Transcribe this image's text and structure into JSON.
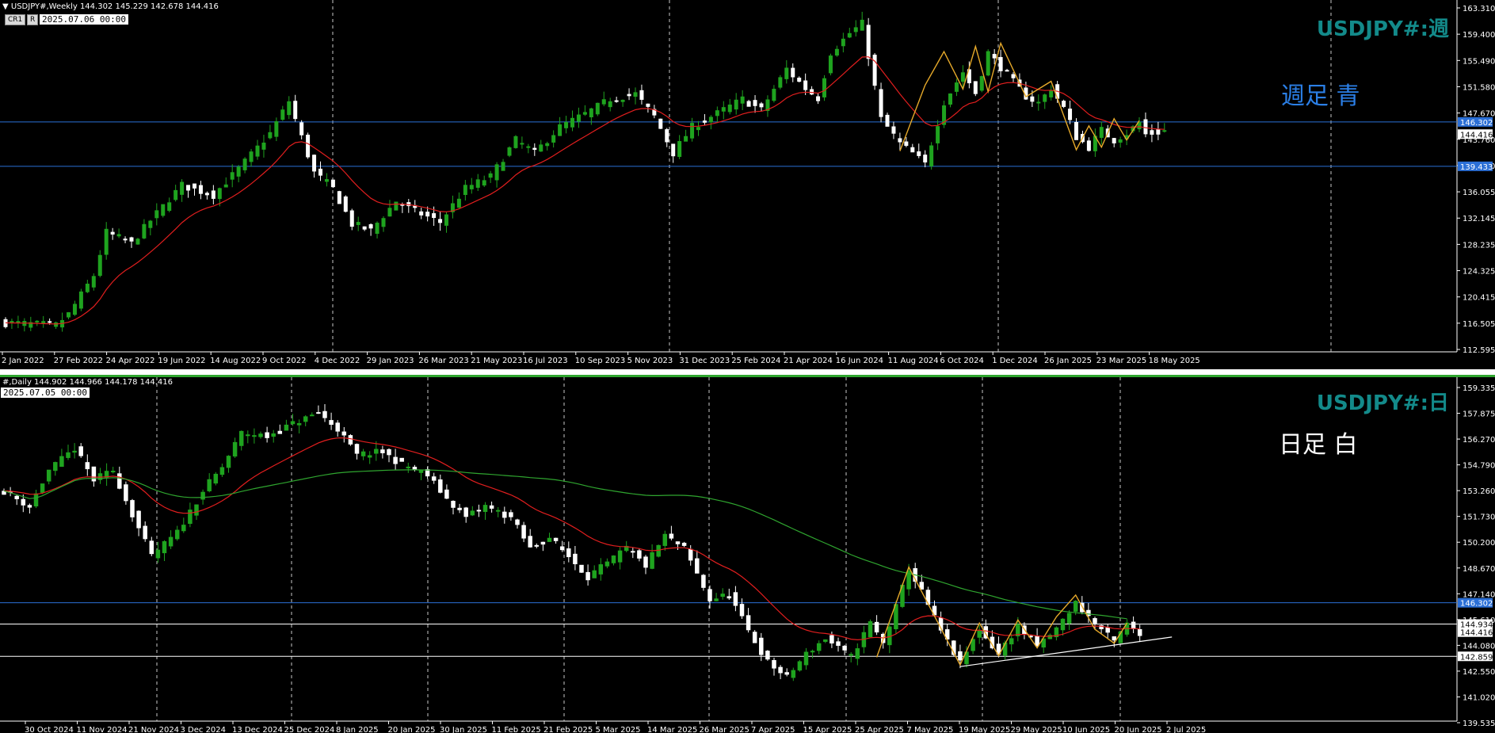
{
  "weekly": {
    "info_text": "USDJPY#,Weekly  144.302 145.229 142.678 144.416",
    "btn_cr1": "CR1",
    "btn_r": "R",
    "date_box": "2025.07.06 00:00",
    "title": "USDJPY#:週",
    "note": "週足  青",
    "note_color": "#2b7fe6",
    "hlines": [
      {
        "price": 146.302,
        "label": "146.302",
        "color": "#2b6fd6"
      },
      {
        "price": 139.433,
        "label": "139.433",
        "color": "#2b6fd6"
      }
    ],
    "current_price": "144.416",
    "chart_data": {
      "type": "candlestick",
      "ylim": [
        111.2,
        164.2
      ],
      "yticks": [
        "163.310",
        "159.400",
        "155.490",
        "151.580",
        "147.670",
        "143.760",
        "139.850",
        "136.055",
        "132.145",
        "128.235",
        "124.325",
        "120.415",
        "116.505",
        "112.595"
      ],
      "xticks": [
        "2 Jan 2022",
        "27 Feb 2022",
        "24 Apr 2022",
        "19 Jun 2022",
        "14 Aug 2022",
        "9 Oct 2022",
        "4 Dec 2022",
        "29 Jan 2023",
        "26 Mar 2023",
        "21 May 2023",
        "16 Jul 2023",
        "10 Sep 2023",
        "5 Nov 2023",
        "31 Dec 2023",
        "25 Feb 2024",
        "21 Apr 2024",
        "16 Jun 2024",
        "11 Aug 2024",
        "6 Oct 2024",
        "1 Dec 2024",
        "26 Jan 2025",
        "23 Mar 2025",
        "18 May 2025"
      ],
      "bars": 185,
      "anchors": [
        [
          0,
          115.2
        ],
        [
          8,
          114.8
        ],
        [
          10,
          116.5
        ],
        [
          14,
          122.5
        ],
        [
          16,
          129.2
        ],
        [
          20,
          127.5
        ],
        [
          23,
          131.0
        ],
        [
          28,
          136.5
        ],
        [
          33,
          135.0
        ],
        [
          37,
          139.0
        ],
        [
          42,
          144.5
        ],
        [
          45,
          149.5
        ],
        [
          47,
          144.0
        ],
        [
          49,
          138.5
        ],
        [
          52,
          136.0
        ],
        [
          55,
          130.5
        ],
        [
          58,
          129.5
        ],
        [
          62,
          134.0
        ],
        [
          65,
          132.5
        ],
        [
          69,
          130.8
        ],
        [
          73,
          136.0
        ],
        [
          77,
          137.8
        ],
        [
          81,
          143.5
        ],
        [
          84,
          141.5
        ],
        [
          88,
          145.5
        ],
        [
          92,
          147.5
        ],
        [
          96,
          149.8
        ],
        [
          100,
          150.6
        ],
        [
          103,
          147.2
        ],
        [
          106,
          141.5
        ],
        [
          109,
          145.5
        ],
        [
          113,
          147.6
        ],
        [
          117,
          149.8
        ],
        [
          120,
          148.2
        ],
        [
          124,
          154.5
        ],
        [
          127,
          151.5
        ],
        [
          129,
          150.0
        ],
        [
          131,
          157.0
        ],
        [
          134,
          160.0
        ],
        [
          136,
          161.5
        ],
        [
          139,
          146.8
        ],
        [
          142,
          143.0
        ],
        [
          144,
          141.5
        ],
        [
          146,
          139.8
        ],
        [
          149,
          149.3
        ],
        [
          152,
          154.0
        ],
        [
          154,
          150.8
        ],
        [
          156,
          157.0
        ],
        [
          158,
          154.8
        ],
        [
          162,
          150.3
        ],
        [
          164,
          149.2
        ],
        [
          166,
          151.5
        ],
        [
          168,
          148.5
        ],
        [
          170,
          144.0
        ],
        [
          172,
          142.4
        ],
        [
          174,
          145.0
        ],
        [
          176,
          143.5
        ],
        [
          178,
          144.5
        ],
        [
          180,
          146.2
        ],
        [
          181,
          144.4
        ]
      ],
      "ma": {
        "name": "",
        "period": 13,
        "color": "#e11e1e"
      },
      "zigzag_color": "#e6a92a"
    }
  },
  "daily": {
    "info_text": "#,Daily  144.902 144.966 144.178 144.416",
    "date_box": "2025.07.05 00:00",
    "title": "USDJPY#:日",
    "note": "日足  白",
    "note_color": "#ffffff",
    "hlines": [
      {
        "price": 146.302,
        "label": "146.302",
        "color": "#2b6fd6"
      },
      {
        "price": 144.934,
        "label": "144.934",
        "color": "#ffffff"
      },
      {
        "price": 142.859,
        "label": "142.859",
        "color": "#ffffff"
      }
    ],
    "current_price": "144.416",
    "chart_data": {
      "type": "candlestick",
      "ylim": [
        139.0,
        160.5
      ],
      "yticks": [
        "159.335",
        "157.875",
        "156.270",
        "154.790",
        "153.260",
        "151.730",
        "150.200",
        "148.670",
        "147.140",
        "145.610",
        "144.080",
        "142.550",
        "141.020",
        "139.535"
      ],
      "xticks": [
        "30 Oct 2024",
        "11 Nov 2024",
        "21 Nov 2024",
        "3 Dec 2024",
        "13 Dec 2024",
        "25 Dec 2024",
        "8 Jan 2025",
        "20 Jan 2025",
        "30 Jan 2025",
        "11 Feb 2025",
        "21 Feb 2025",
        "5 Mar 2025",
        "14 Mar 2025",
        "26 Mar 2025",
        "7 Apr 2025",
        "15 Apr 2025",
        "25 Apr 2025",
        "7 May 2025",
        "19 May 2025",
        "29 May 2025",
        "10 Jun 2025",
        "20 Jun 2025",
        "2 Jul 2025"
      ],
      "bars": 178,
      "anchors": [
        [
          0,
          153.5
        ],
        [
          4,
          152.5
        ],
        [
          7,
          154.8
        ],
        [
          11,
          156.2
        ],
        [
          14,
          154.2
        ],
        [
          17,
          154.8
        ],
        [
          20,
          152.0
        ],
        [
          23,
          149.3
        ],
        [
          27,
          150.8
        ],
        [
          31,
          153.5
        ],
        [
          34,
          155.0
        ],
        [
          37,
          157.2
        ],
        [
          41,
          157.0
        ],
        [
          45,
          157.8
        ],
        [
          49,
          158.5
        ],
        [
          52,
          157.5
        ],
        [
          55,
          155.8
        ],
        [
          59,
          156.0
        ],
        [
          62,
          155.2
        ],
        [
          66,
          154.5
        ],
        [
          69,
          153.0
        ],
        [
          72,
          151.8
        ],
        [
          75,
          152.5
        ],
        [
          79,
          151.8
        ],
        [
          82,
          149.8
        ],
        [
          85,
          150.5
        ],
        [
          88,
          149.3
        ],
        [
          91,
          148.0
        ],
        [
          94,
          148.8
        ],
        [
          97,
          149.8
        ],
        [
          100,
          148.7
        ],
        [
          103,
          150.6
        ],
        [
          106,
          149.8
        ],
        [
          110,
          146.5
        ],
        [
          113,
          146.8
        ],
        [
          116,
          144.5
        ],
        [
          119,
          142.5
        ],
        [
          122,
          141.5
        ],
        [
          125,
          143.0
        ],
        [
          128,
          144.0
        ],
        [
          132,
          142.8
        ],
        [
          135,
          145.0
        ],
        [
          137,
          143.7
        ],
        [
          139,
          146.0
        ],
        [
          141,
          148.5
        ],
        [
          143,
          147.0
        ],
        [
          146,
          144.5
        ],
        [
          149,
          142.4
        ],
        [
          152,
          144.6
        ],
        [
          155,
          143.0
        ],
        [
          158,
          144.8
        ],
        [
          161,
          143.5
        ],
        [
          164,
          144.6
        ],
        [
          167,
          146.3
        ],
        [
          170,
          145.0
        ],
        [
          173,
          143.8
        ],
        [
          175,
          144.9
        ],
        [
          177,
          144.4
        ]
      ],
      "ma_fast": {
        "name": "",
        "color": "#e11e1e"
      },
      "ma_slow": {
        "name": "",
        "color": "#2fa52f"
      },
      "zigzag_color": "#e6a92a",
      "trendline_color": "#ffffff"
    }
  }
}
